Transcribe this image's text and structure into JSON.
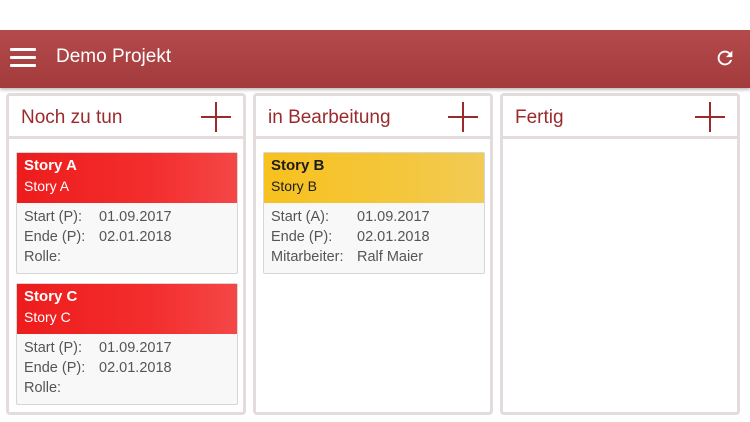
{
  "header": {
    "title": "Demo Projekt",
    "menu_icon": "menu-icon",
    "refresh_icon": "refresh-icon",
    "color": "#a33a3c"
  },
  "columns": [
    {
      "title": "Noch zu tun",
      "cards": [
        {
          "title": "Story A",
          "subtitle": "Story A",
          "color": "#ee1c1c",
          "start_label": "Start  (P):",
          "start": "01.09.2017",
          "end_label": "Ende  (P):",
          "end": "02.01.2018",
          "role_label": "Rolle:",
          "role": ""
        },
        {
          "title": "Story C",
          "subtitle": "Story C",
          "color": "#ee1c1c",
          "start_label": "Start  (P):",
          "start": "01.09.2017",
          "end_label": "Ende  (P):",
          "end": "02.01.2018",
          "role_label": "Rolle:",
          "role": ""
        }
      ]
    },
    {
      "title": "in Bearbeitung",
      "cards": [
        {
          "title": "Story B",
          "subtitle": "Story B",
          "color": "#f7c11e",
          "start_label": "Start    (A):",
          "start": "01.09.2017",
          "end_label": "Ende    (P):",
          "end": "02.01.2018",
          "role_label": "Mitarbeiter:",
          "role": "Ralf Maier"
        }
      ]
    },
    {
      "title": "Fertig",
      "cards": []
    }
  ]
}
